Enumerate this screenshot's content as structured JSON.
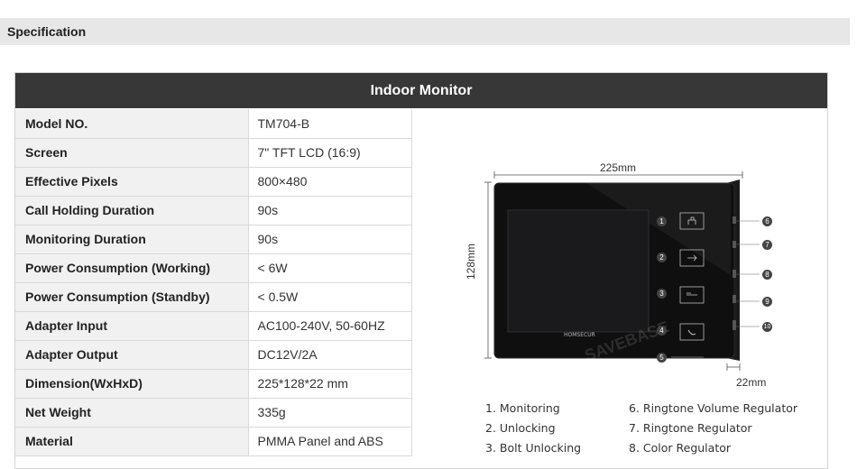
{
  "section_title": "Specification",
  "table_title": "Indoor Monitor",
  "specs": [
    {
      "label": "Model NO.",
      "value": "TM704-B"
    },
    {
      "label": "Screen",
      "value": "7\" TFT LCD (16:9)"
    },
    {
      "label": "Effective Pixels",
      "value": "800×480"
    },
    {
      "label": "Call Holding Duration",
      "value": "90s"
    },
    {
      "label": "Monitoring Duration",
      "value": "90s"
    },
    {
      "label": "Power Consumption (Working)",
      "value": "< 6W"
    },
    {
      "label": "Power Consumption (Standby)",
      "value": "< 0.5W"
    },
    {
      "label": "Adapter Input",
      "value": "AC100-240V, 50-60HZ"
    },
    {
      "label": "Adapter Output",
      "value": "DC12V/2A"
    },
    {
      "label": "Dimension(WxHxD)",
      "value": "225*128*22 mm"
    },
    {
      "label": "Net Weight",
      "value": "335g"
    },
    {
      "label": "Material",
      "value": "PMMA Panel and ABS"
    }
  ],
  "diagram": {
    "width_label": "225mm",
    "height_label": "128mm",
    "depth_label": "22mm",
    "brand": "HOMSECUR",
    "watermark": "SAVEBASE",
    "front_numbers": [
      "1",
      "2",
      "3",
      "4",
      "5"
    ],
    "side_numbers": [
      "6",
      "7",
      "8",
      "9",
      "10"
    ]
  },
  "legend": {
    "left": [
      "1. Monitoring",
      "2. Unlocking",
      "3. Bolt Unlocking"
    ],
    "right": [
      "6. Ringtone Volume Regulator",
      "7. Ringtone Regulator",
      "8. Color Regulator"
    ]
  },
  "colors": {
    "header_bg": "#373737",
    "label_bg": "#f1f1f1",
    "section_bg": "#e7e7e7"
  }
}
